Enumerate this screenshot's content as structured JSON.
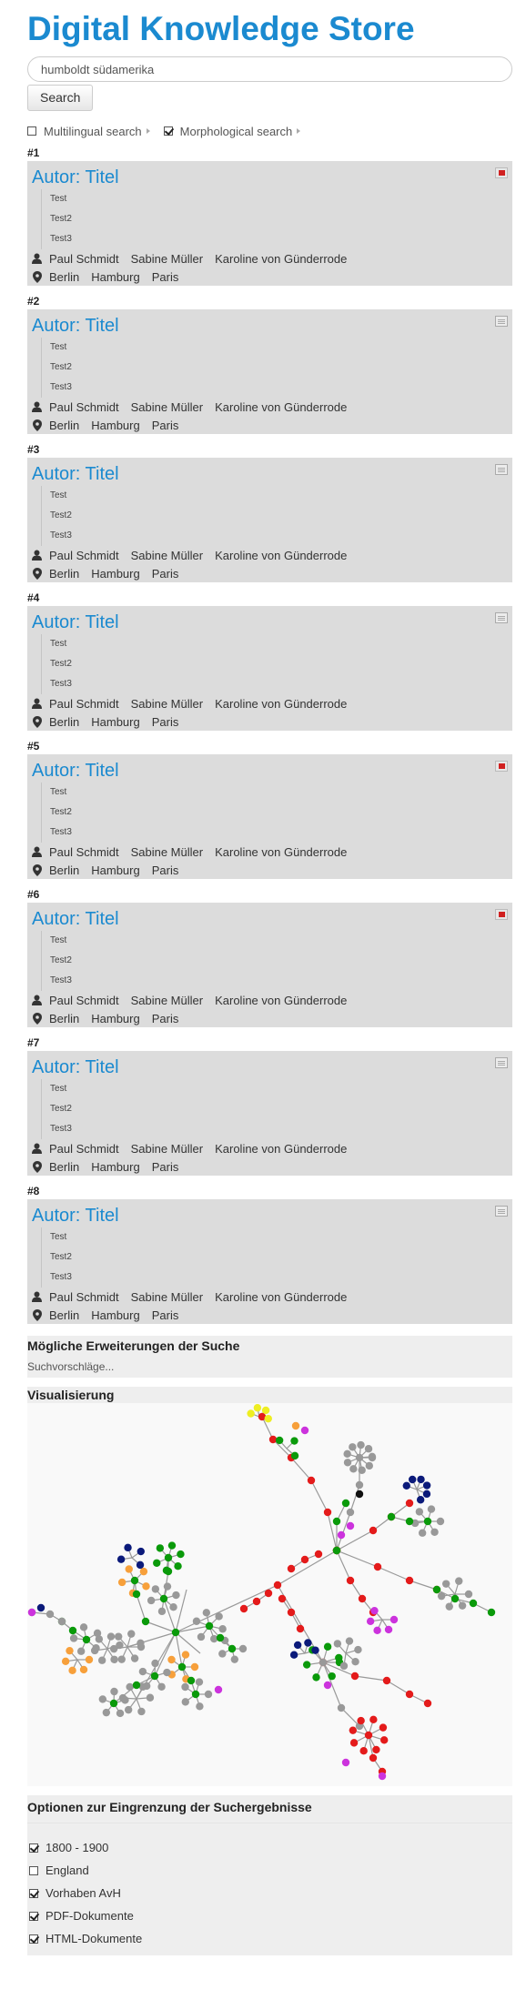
{
  "app_title": "Digital Knowledge Store",
  "search": {
    "value": "humboldt südamerika",
    "button_label": "Search"
  },
  "search_options": [
    {
      "label": "Multilingual search",
      "checked": false
    },
    {
      "label": "Morphological search",
      "checked": true
    }
  ],
  "results": [
    {
      "num": "#1",
      "title": "Autor: Titel",
      "lines": [
        "Test",
        "Test2",
        "Test3"
      ],
      "persons": [
        "Paul Schmidt",
        "Sabine Müller",
        "Karoline von Günderrode"
      ],
      "places": [
        "Berlin",
        "Hamburg",
        "Paris"
      ],
      "doc_type": "pdf-icon"
    },
    {
      "num": "#2",
      "title": "Autor: Titel",
      "lines": [
        "Test",
        "Test2",
        "Test3"
      ],
      "persons": [
        "Paul Schmidt",
        "Sabine Müller",
        "Karoline von Günderrode"
      ],
      "places": [
        "Berlin",
        "Hamburg",
        "Paris"
      ],
      "doc_type": "html-icon"
    },
    {
      "num": "#3",
      "title": "Autor: Titel",
      "lines": [
        "Test",
        "Test2",
        "Test3"
      ],
      "persons": [
        "Paul Schmidt",
        "Sabine Müller",
        "Karoline von Günderrode"
      ],
      "places": [
        "Berlin",
        "Hamburg",
        "Paris"
      ],
      "doc_type": "html-icon"
    },
    {
      "num": "#4",
      "title": "Autor: Titel",
      "lines": [
        "Test",
        "Test2",
        "Test3"
      ],
      "persons": [
        "Paul Schmidt",
        "Sabine Müller",
        "Karoline von Günderrode"
      ],
      "places": [
        "Berlin",
        "Hamburg",
        "Paris"
      ],
      "doc_type": "html-icon"
    },
    {
      "num": "#5",
      "title": "Autor: Titel",
      "lines": [
        "Test",
        "Test2",
        "Test3"
      ],
      "persons": [
        "Paul Schmidt",
        "Sabine Müller",
        "Karoline von Günderrode"
      ],
      "places": [
        "Berlin",
        "Hamburg",
        "Paris"
      ],
      "doc_type": "pdf-icon"
    },
    {
      "num": "#6",
      "title": "Autor: Titel",
      "lines": [
        "Test",
        "Test2",
        "Test3"
      ],
      "persons": [
        "Paul Schmidt",
        "Sabine Müller",
        "Karoline von Günderrode"
      ],
      "places": [
        "Berlin",
        "Hamburg",
        "Paris"
      ],
      "doc_type": "pdf-icon"
    },
    {
      "num": "#7",
      "title": "Autor: Titel",
      "lines": [
        "Test",
        "Test2",
        "Test3"
      ],
      "persons": [
        "Paul Schmidt",
        "Sabine Müller",
        "Karoline von Günderrode"
      ],
      "places": [
        "Berlin",
        "Hamburg",
        "Paris"
      ],
      "doc_type": "html-icon"
    },
    {
      "num": "#8",
      "title": "Autor: Titel",
      "lines": [
        "Test",
        "Test2",
        "Test3"
      ],
      "persons": [
        "Paul Schmidt",
        "Sabine Müller",
        "Karoline von Günderrode"
      ],
      "places": [
        "Berlin",
        "Hamburg",
        "Paris"
      ],
      "doc_type": "html-icon"
    }
  ],
  "suggestions": {
    "heading": "Mögliche Erweiterungen der Suche",
    "text": "Suchvorschläge..."
  },
  "visualization": {
    "heading": "Visualisierung",
    "node_colors": {
      "gray": "#999999",
      "green": "#0a9a0a",
      "red": "#e41b1b",
      "orange": "#f7a03b",
      "blue": "#0b1a7a",
      "magenta": "#cc33dd",
      "yellow": "#eeee22",
      "black": "#111111"
    }
  },
  "filters": {
    "heading": "Optionen zur Eingrenzung der Suchergebnisse",
    "items": [
      {
        "label": "1800 - 1900",
        "checked": true
      },
      {
        "label": "England",
        "checked": false
      },
      {
        "label": "Vorhaben AvH",
        "checked": true
      },
      {
        "label": "PDF-Dokumente",
        "checked": true
      },
      {
        "label": "HTML-Dokumente",
        "checked": true
      }
    ]
  },
  "colors": {
    "accent": "#1b8ad0",
    "card_bg": "#dcdcdc",
    "section_bg": "#eeeeee"
  }
}
